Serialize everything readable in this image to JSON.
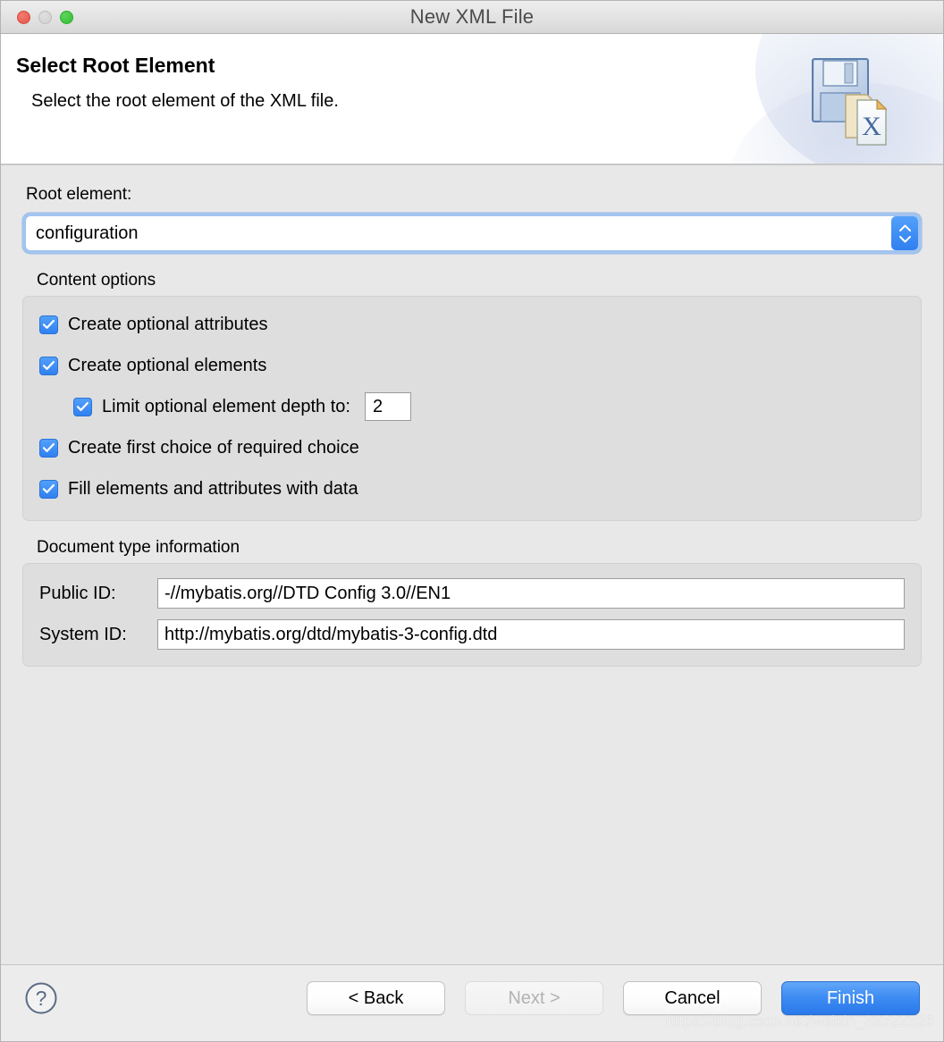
{
  "window": {
    "title": "New XML File",
    "traffic_lights": [
      "close-button",
      "minimize-button",
      "maximize-button"
    ]
  },
  "header": {
    "title": "Select Root Element",
    "description": "Select the root element of the XML file.",
    "icon": "floppy-xml-document-icon"
  },
  "root_element": {
    "label": "Root element:",
    "value": "configuration",
    "stepper_icon": "chevron-up-down-icon"
  },
  "content_options": {
    "group_label": "Content options",
    "items": [
      {
        "label": "Create optional attributes",
        "checked": true,
        "indent": false
      },
      {
        "label": "Create optional elements",
        "checked": true,
        "indent": false
      },
      {
        "label": "Limit optional element depth to:",
        "checked": true,
        "indent": true,
        "depth_value": "2"
      },
      {
        "label": "Create first choice of required choice",
        "checked": true,
        "indent": false
      },
      {
        "label": "Fill elements and attributes with data",
        "checked": true,
        "indent": false
      }
    ]
  },
  "document_type": {
    "group_label": "Document type information",
    "public_id_label": "Public ID:",
    "public_id_value": "-//mybatis.org//DTD Config 3.0//EN1",
    "system_id_label": "System ID:",
    "system_id_value": "http://mybatis.org/dtd/mybatis-3-config.dtd"
  },
  "footer": {
    "help_icon": "question-mark-help-icon",
    "back_label": "< Back",
    "next_label": "Next >",
    "cancel_label": "Cancel",
    "finish_label": "Finish",
    "next_disabled": true
  },
  "watermark": "https://blog.csdn.net/weixin_38322326",
  "colors": {
    "accent_blue": "#3d8bf3",
    "window_bg": "#e8e8e8",
    "group_bg": "#dedede",
    "focus_ring": "#a3c4ee"
  }
}
